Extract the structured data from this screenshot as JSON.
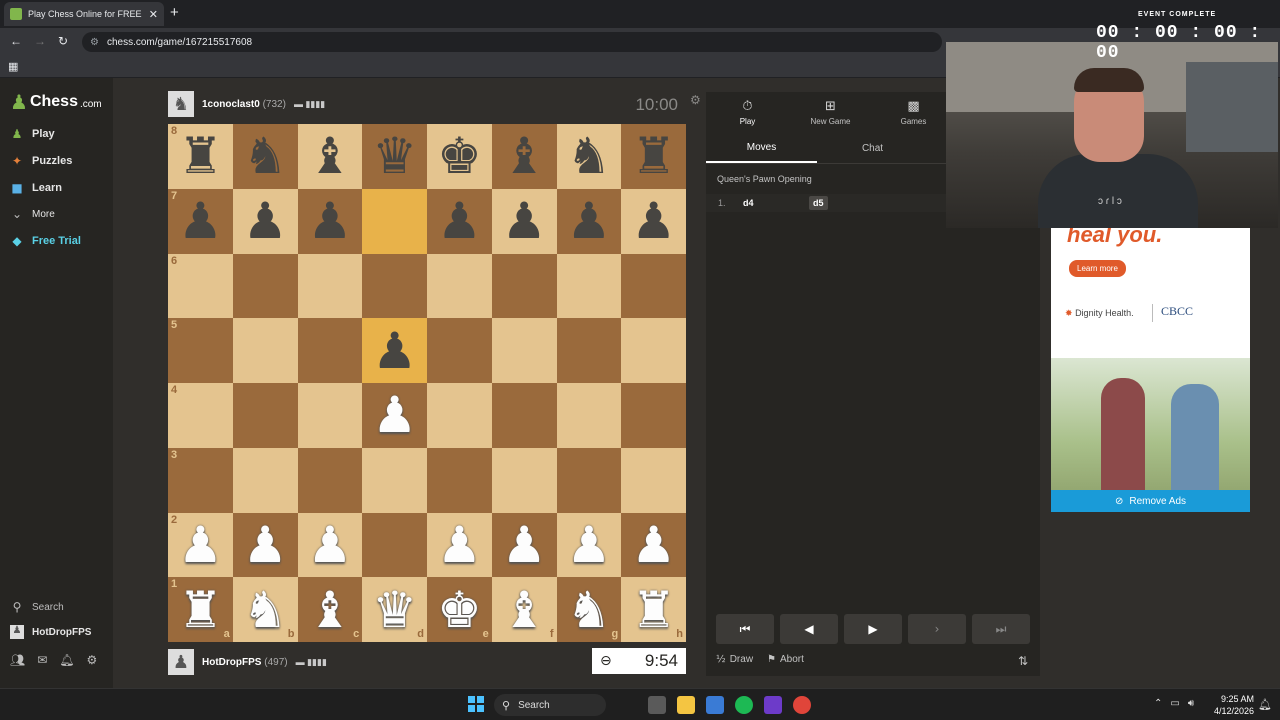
{
  "browser": {
    "tab_title": "Play Chess Online for FREE - 2 P",
    "url": "chess.com/game/167215517608"
  },
  "sidebar": {
    "logo_text": "Chess",
    "logo_suffix": ".com",
    "items": [
      {
        "label": "Play",
        "icon": "play-icon",
        "color": "#81b64c"
      },
      {
        "label": "Puzzles",
        "icon": "puzzle-icon",
        "color": "#e5803a"
      },
      {
        "label": "Learn",
        "icon": "learn-icon",
        "color": "#5ab1e6"
      },
      {
        "label": "More",
        "icon": "chevron-down-icon",
        "color": "#bdbdbd"
      },
      {
        "label": "Free Trial",
        "icon": "diamond-icon",
        "color": "#5ad1e6"
      }
    ],
    "search_label": "Search",
    "user_label": "HotDropFPS"
  },
  "top_player": {
    "name": "1conoclast0",
    "rating": "(732)",
    "clock": "10:00"
  },
  "bottom_player": {
    "name": "HotDropFPS",
    "rating": "(497)",
    "clock": "9:54"
  },
  "board": {
    "ranks": [
      "8",
      "7",
      "6",
      "5",
      "4",
      "3",
      "2",
      "1"
    ],
    "files": [
      "a",
      "b",
      "c",
      "d",
      "e",
      "f",
      "g",
      "h"
    ],
    "rows": [
      [
        "br",
        "bn",
        "bb",
        "bq",
        "bk",
        "bb",
        "bn",
        "br"
      ],
      [
        "bp",
        "bp",
        "bp",
        "",
        "bp",
        "bp",
        "bp",
        "bp"
      ],
      [
        "",
        "",
        "",
        "",
        "",
        "",
        "",
        ""
      ],
      [
        "",
        "",
        "",
        "bp",
        "",
        "",
        "",
        ""
      ],
      [
        "",
        "",
        "",
        "wp",
        "",
        "",
        "",
        ""
      ],
      [
        "",
        "",
        "",
        "",
        "",
        "",
        "",
        ""
      ],
      [
        "wp",
        "wp",
        "wp",
        "",
        "wp",
        "wp",
        "wp",
        "wp"
      ],
      [
        "wr",
        "wn",
        "wb",
        "wq",
        "wk",
        "wb",
        "wn",
        "wr"
      ]
    ],
    "highlight": [
      "d7",
      "d5"
    ]
  },
  "panel": {
    "tabs": [
      {
        "label": "Play",
        "icon": "stopwatch-icon"
      },
      {
        "label": "New Game",
        "icon": "plus-square-icon"
      },
      {
        "label": "Games",
        "icon": "board-icon"
      }
    ],
    "subtabs": [
      "Moves",
      "Chat"
    ],
    "opening": "Queen's Pawn Opening",
    "moves": [
      {
        "num": "1.",
        "white": "d4",
        "black": "d5"
      }
    ],
    "actions": {
      "draw": "Draw",
      "draw_icon": "½",
      "abort": "Abort"
    }
  },
  "ad": {
    "headline": "heal you.",
    "learn_more": "Learn more",
    "brand1": "Dignity Health.",
    "brand2": "CBCC",
    "remove_ads": "Remove Ads"
  },
  "stream_overlay": {
    "timer_label": "EVENT COMPLETE",
    "timer_value": "00 : 00 : 00 : 00",
    "shirt_text": "ɔ ɾ l ɔ"
  },
  "taskbar": {
    "search_label": "Search",
    "time": "9:25 AM",
    "date": "4/12/2026"
  }
}
